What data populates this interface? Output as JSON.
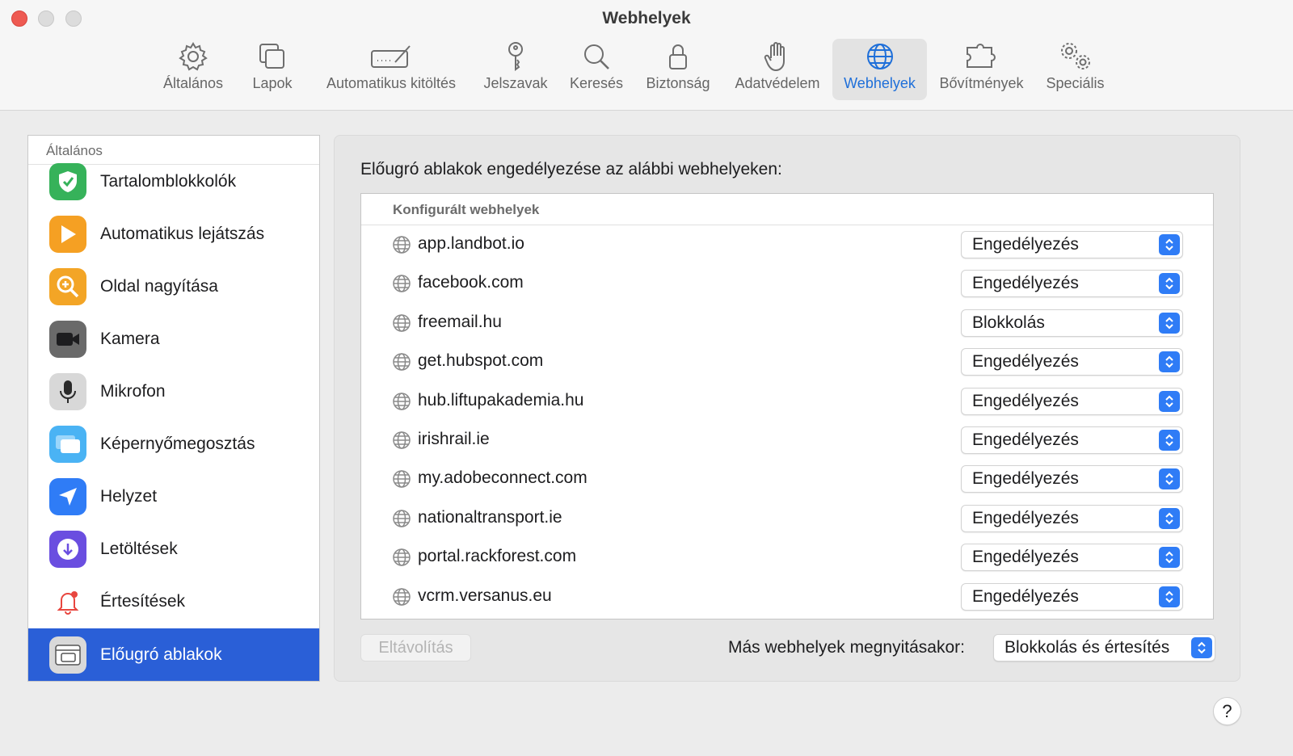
{
  "window": {
    "title": "Webhelyek"
  },
  "toolbar": {
    "tabs": [
      {
        "label": "Általános",
        "icon": "gear-icon"
      },
      {
        "label": "Lapok",
        "icon": "tabs-icon"
      },
      {
        "label": "Automatikus kitöltés",
        "icon": "autofill-icon"
      },
      {
        "label": "Jelszavak",
        "icon": "key-icon"
      },
      {
        "label": "Keresés",
        "icon": "search-icon"
      },
      {
        "label": "Biztonság",
        "icon": "lock-icon"
      },
      {
        "label": "Adatvédelem",
        "icon": "hand-icon"
      },
      {
        "label": "Webhelyek",
        "icon": "globe-icon",
        "active": true
      },
      {
        "label": "Bővítmények",
        "icon": "puzzle-icon"
      },
      {
        "label": "Speciális",
        "icon": "gears-icon"
      }
    ]
  },
  "sidebar": {
    "header": "Általános",
    "items": [
      {
        "label": "Tartalomblokkolók",
        "icon": "content-blocker-icon"
      },
      {
        "label": "Automatikus lejátszás",
        "icon": "autoplay-icon"
      },
      {
        "label": "Oldal nagyítása",
        "icon": "zoom-icon"
      },
      {
        "label": "Kamera",
        "icon": "camera-icon"
      },
      {
        "label": "Mikrofon",
        "icon": "microphone-icon"
      },
      {
        "label": "Képernyőmegosztás",
        "icon": "screen-sharing-icon"
      },
      {
        "label": "Helyzet",
        "icon": "location-icon"
      },
      {
        "label": "Letöltések",
        "icon": "downloads-icon"
      },
      {
        "label": "Értesítések",
        "icon": "notifications-icon"
      },
      {
        "label": "Előugró ablakok",
        "icon": "popup-windows-icon",
        "selected": true
      }
    ]
  },
  "main": {
    "title": "Előugró ablakok engedélyezése az alábbi webhelyeken:",
    "table_header": "Konfigurált webhelyek",
    "sites": [
      {
        "site": "app.landbot.io",
        "setting": "Engedélyezés"
      },
      {
        "site": "facebook.com",
        "setting": "Engedélyezés"
      },
      {
        "site": "freemail.hu",
        "setting": "Blokkolás"
      },
      {
        "site": "get.hubspot.com",
        "setting": "Engedélyezés"
      },
      {
        "site": "hub.liftupakademia.hu",
        "setting": "Engedélyezés"
      },
      {
        "site": "irishrail.ie",
        "setting": "Engedélyezés"
      },
      {
        "site": "my.adobeconnect.com",
        "setting": "Engedélyezés"
      },
      {
        "site": "nationaltransport.ie",
        "setting": "Engedélyezés"
      },
      {
        "site": "portal.rackforest.com",
        "setting": "Engedélyezés"
      },
      {
        "site": "vcrm.versanus.eu",
        "setting": "Engedélyezés"
      }
    ],
    "remove_label": "Eltávolítás",
    "other_sites_label": "Más webhelyek megnyitásakor:",
    "other_sites_value": "Blokkolás és értesítés"
  },
  "help": {
    "label": "?"
  },
  "colors": {
    "accent": "#2f7cf6",
    "selection": "#2a5fd7",
    "close": "#ee5a52"
  }
}
